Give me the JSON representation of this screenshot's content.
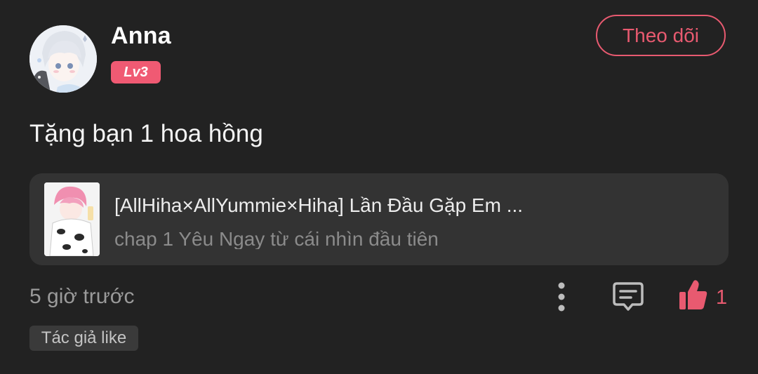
{
  "user": {
    "name": "Anna",
    "level": "Lv3"
  },
  "follow_button_label": "Theo dõi",
  "post": {
    "text": "Tặng bạn 1 hoa hồng",
    "story": {
      "title": "[AllHiha×AllYummie×Hiha] Lần Đầu Gặp Em ...",
      "chapter": "chap 1 Yêu Ngay từ cái nhìn đầu tiên"
    },
    "time": "5 giờ trước",
    "like_count": "1",
    "author_like_tag": "Tác giả like"
  },
  "icons": {
    "more": "vertical-dots-icon",
    "comment": "comment-bubble-icon",
    "like": "thumbs-up-icon"
  },
  "colors": {
    "background": "#222222",
    "card": "#333333",
    "accent": "#e85a70",
    "badge": "#f05a73"
  }
}
